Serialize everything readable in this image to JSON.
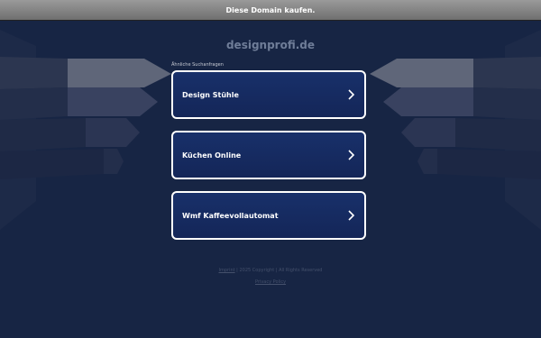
{
  "topbar": {
    "link_text": "Diese Domain kaufen."
  },
  "domain_title": "designprofi.de",
  "related": {
    "label": "Ähnliche Suchanfragen",
    "items": [
      {
        "label": "Design Stühle"
      },
      {
        "label": "Küchen Online"
      },
      {
        "label": "Wmf Kaffeevollautomat"
      }
    ]
  },
  "footer": {
    "imprint": "Imprint",
    "copyright": " | 2025 Copyright | All Rights Reserved",
    "privacy": "Privacy Policy"
  },
  "colors": {
    "background": "#152040",
    "card_bg": "#18306a",
    "card_border": "#ffffff",
    "topbar": "#8a8a8a"
  },
  "icons": {
    "card_arrow": "chevron-right-icon"
  }
}
